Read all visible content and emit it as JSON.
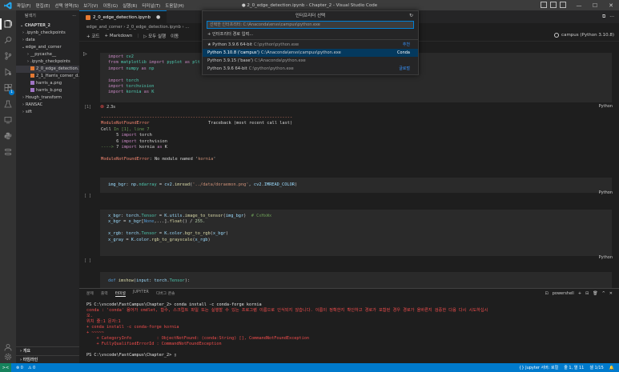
{
  "titlebar": {
    "menu": [
      "파일(F)",
      "편집(E)",
      "선택 영역(S)",
      "보기(V)",
      "이동(G)",
      "실행(R)",
      "터미널(T)",
      "도움말(H)"
    ],
    "title": "● 2_0_edge_detection.ipynb - Chapter_2 - Visual Studio Code",
    "minimize": "—",
    "maximize": "☐",
    "close": "✕"
  },
  "activity": {
    "extensions_badge": "1"
  },
  "sidebar": {
    "header": "탐색기",
    "header_more": "···",
    "section": "CHAPTER_2",
    "items": [
      {
        "label": ".ipynb_checkpoints",
        "indent": 0,
        "type": "folder",
        "expanded": false
      },
      {
        "label": "data",
        "indent": 0,
        "type": "folder",
        "expanded": false
      },
      {
        "label": "edge_and_corner",
        "indent": 0,
        "type": "folder",
        "expanded": true
      },
      {
        "label": "__pycache__",
        "indent": 1,
        "type": "folder",
        "expanded": false
      },
      {
        "label": ".ipynb_checkpoints",
        "indent": 1,
        "type": "folder",
        "expanded": false
      },
      {
        "label": "2_0_edge_detection....",
        "indent": 1,
        "type": "notebook",
        "selected": true
      },
      {
        "label": "2_1_Harris_corner_d...",
        "indent": 1,
        "type": "notebook"
      },
      {
        "label": "harris_a.png",
        "indent": 1,
        "type": "image"
      },
      {
        "label": "harris_b.png",
        "indent": 1,
        "type": "image"
      },
      {
        "label": "Hough_transform",
        "indent": 0,
        "type": "folder",
        "expanded": false
      },
      {
        "label": "RANSAC",
        "indent": 0,
        "type": "folder",
        "expanded": false
      },
      {
        "label": "sift",
        "indent": 0,
        "type": "folder",
        "expanded": false
      }
    ],
    "outline": "개요",
    "timeline": "타임라인"
  },
  "tabs": [
    {
      "label": "2_0_edge_detection.ipynb",
      "close": "●"
    }
  ],
  "breadcrumb": "edge_and_corner  ›  2_0_edge_detection.ipynb  ›  ...",
  "toolbar": {
    "code": "+ 코드",
    "markdown": "+ Markdown",
    "run_all": "▷ 모두 실행",
    "move": "이동",
    "kernel": "campus (Python 3.10.8)"
  },
  "palette": {
    "title": "인터프리터 선택",
    "refresh": "↻",
    "placeholder": "선택한 인터프리터: C:\\Anaconda\\envs\\campus\\python.exe",
    "items": [
      {
        "label": "+  인터프리터 경로 입력...",
        "path": "",
        "tag": ""
      },
      {
        "label": "★ Python 3.9.6 64-bit",
        "path": "C:\\python\\python.exe",
        "tag": "추천"
      },
      {
        "label": "Python 3.10.8 ('campus')",
        "path": "C:\\Anaconda\\envs\\campus\\python.exe",
        "tag": "Conda",
        "active": true
      },
      {
        "label": "Python 3.9.15 ('base')",
        "path": "C:\\Anaconda\\python.exe",
        "tag": ""
      },
      {
        "label": "Python 3.9.6 64-bit",
        "path": "C:\\python\\python.exe",
        "tag": "글로벌"
      }
    ]
  },
  "cells": {
    "cell1": {
      "exec": "[1]",
      "lang": "Python",
      "status_icon": "⊗",
      "status_time": "2.3s",
      "lines": [
        [
          [
            "kw",
            "import "
          ],
          [
            "mod",
            "cv2"
          ]
        ],
        [
          [
            "kw",
            "from "
          ],
          [
            "mod",
            "matplotlib "
          ],
          [
            "kw",
            "import "
          ],
          [
            "mod",
            "pyplot "
          ],
          [
            "kw",
            "as "
          ],
          [
            "mod",
            "plt"
          ]
        ],
        [
          [
            "kw",
            "import "
          ],
          [
            "mod",
            "numpy "
          ],
          [
            "kw",
            "as "
          ],
          [
            "mod",
            "np"
          ]
        ],
        [
          [
            "plain",
            ""
          ]
        ],
        [
          [
            "kw",
            "import "
          ],
          [
            "mod",
            "torch"
          ]
        ],
        [
          [
            "kw",
            "import "
          ],
          [
            "mod",
            "torchvision"
          ]
        ],
        [
          [
            "kw",
            "import "
          ],
          [
            "mod",
            "kornia "
          ],
          [
            "kw",
            "as "
          ],
          [
            "mod",
            "K"
          ]
        ]
      ]
    },
    "error": {
      "divider": "---------------------------------------------------------------------------",
      "lines": [
        [
          [
            "err",
            "ModuleNotFoundError"
          ],
          [
            "plain",
            "                       Traceback (most recent call last)"
          ]
        ],
        [
          [
            "plain",
            "Cell "
          ],
          [
            "grn",
            "In [1], line 7"
          ]
        ],
        [
          [
            "plain",
            "      5 "
          ],
          [
            "kw",
            "import "
          ],
          [
            "plain",
            "torch"
          ]
        ],
        [
          [
            "plain",
            "      6 "
          ],
          [
            "kw",
            "import "
          ],
          [
            "plain",
            "torchvision"
          ]
        ],
        [
          [
            "grn",
            "----> "
          ],
          [
            "plain",
            "7 "
          ],
          [
            "kw",
            "import "
          ],
          [
            "plain",
            "kornia "
          ],
          [
            "kw",
            "as "
          ],
          [
            "plain",
            "K"
          ]
        ],
        [
          [
            "plain",
            ""
          ]
        ],
        [
          [
            "err",
            "ModuleNotFoundError"
          ],
          [
            "plain",
            ": No module named '"
          ],
          [
            "str",
            "kornia"
          ],
          [
            "plain",
            "'"
          ]
        ]
      ]
    },
    "cell2": {
      "exec": "[ ]",
      "lang": "Python",
      "lines": [
        [
          [
            "var",
            "img_bgr"
          ],
          [
            "plain",
            ": "
          ],
          [
            "var",
            "np"
          ],
          [
            "plain",
            "."
          ],
          [
            "mod",
            "ndarray"
          ],
          [
            "plain",
            " = "
          ],
          [
            "var",
            "cv2"
          ],
          [
            "plain",
            "."
          ],
          [
            "fn",
            "imread"
          ],
          [
            "plain",
            "("
          ],
          [
            "str",
            "'../data/doraemon.png'"
          ],
          [
            "plain",
            ", "
          ],
          [
            "var",
            "cv2"
          ],
          [
            "plain",
            "."
          ],
          [
            "var",
            "IMREAD_COLOR"
          ],
          [
            "plain",
            ")"
          ]
        ]
      ]
    },
    "cell3": {
      "exec": "[ ]",
      "lang": "Python",
      "lines": [
        [
          [
            "var",
            "x_bgr"
          ],
          [
            "plain",
            ": "
          ],
          [
            "var",
            "torch"
          ],
          [
            "plain",
            "."
          ],
          [
            "mod",
            "Tensor"
          ],
          [
            "plain",
            " = "
          ],
          [
            "var",
            "K"
          ],
          [
            "plain",
            "."
          ],
          [
            "var",
            "utils"
          ],
          [
            "plain",
            "."
          ],
          [
            "fn",
            "image_to_tensor"
          ],
          [
            "plain",
            "("
          ],
          [
            "var",
            "img_bgr"
          ],
          [
            "plain",
            ")  "
          ],
          [
            "cm",
            "# CxHxWx"
          ]
        ],
        [
          [
            "var",
            "x_bgr"
          ],
          [
            "plain",
            " = "
          ],
          [
            "var",
            "x_bgr"
          ],
          [
            "plain",
            "["
          ],
          [
            "blu",
            "None"
          ],
          [
            "plain",
            ",...]."
          ],
          [
            "fn",
            "float"
          ],
          [
            "plain",
            "() / "
          ],
          [
            "num",
            "255."
          ]
        ],
        [
          [
            "plain",
            ""
          ]
        ],
        [
          [
            "var",
            "x_rgb"
          ],
          [
            "plain",
            ": "
          ],
          [
            "var",
            "torch"
          ],
          [
            "plain",
            "."
          ],
          [
            "mod",
            "Tensor"
          ],
          [
            "plain",
            " = "
          ],
          [
            "var",
            "K"
          ],
          [
            "plain",
            "."
          ],
          [
            "var",
            "color"
          ],
          [
            "plain",
            "."
          ],
          [
            "fn",
            "bgr_to_rgb"
          ],
          [
            "plain",
            "("
          ],
          [
            "var",
            "x_bgr"
          ],
          [
            "plain",
            ")"
          ]
        ],
        [
          [
            "var",
            "x_gray"
          ],
          [
            "plain",
            " = "
          ],
          [
            "var",
            "K"
          ],
          [
            "plain",
            "."
          ],
          [
            "var",
            "color"
          ],
          [
            "plain",
            "."
          ],
          [
            "fn",
            "rgb_to_grayscale"
          ],
          [
            "plain",
            "("
          ],
          [
            "var",
            "x_rgb"
          ],
          [
            "plain",
            ")"
          ]
        ]
      ]
    },
    "cell4": {
      "lines": [
        [
          [
            "blu",
            "def "
          ],
          [
            "fn",
            "imshow"
          ],
          [
            "plain",
            "("
          ],
          [
            "var",
            "input"
          ],
          [
            "plain",
            ": "
          ],
          [
            "var",
            "torch"
          ],
          [
            "plain",
            "."
          ],
          [
            "mod",
            "Tensor"
          ],
          [
            "plain",
            "):"
          ]
        ]
      ]
    }
  },
  "panel": {
    "tabs": [
      "문제",
      "출력",
      "터미널",
      "JUPYTER",
      "디버그 콘솔"
    ],
    "active_tab": 2,
    "shell": "powershell",
    "right_icons": [
      "+",
      "⊟",
      "🗑",
      "^",
      "✕"
    ],
    "terminal": [
      {
        "cls": "term-white",
        "text": "PS C:\\vscode\\FastCampus\\Chapter_2> conda install -c conda-forge kornia"
      },
      {
        "cls": "term-red",
        "text": "conda : 'conda' 용어가 cmdlet, 함수, 스크립트 파일 또는 실행할 수 있는 프로그램 이름으로 인식되지 않습니다. 이름이 정확한지 확인하고 경로가 포함된 경우 경로가 올바른지 검증한 다음 다시 시도하십시"
      },
      {
        "cls": "term-red",
        "text": "오."
      },
      {
        "cls": "term-red",
        "text": "위치 줄:1 문자:1"
      },
      {
        "cls": "term-red",
        "text": "+ conda install -c conda-forge kornia"
      },
      {
        "cls": "term-red",
        "text": "+ ~~~~~"
      },
      {
        "cls": "term-red",
        "text": "    + CategoryInfo          : ObjectNotFound: (conda:String) [], CommandNotFoundException"
      },
      {
        "cls": "term-red",
        "text": "    + FullyQualifiedErrorId : CommandNotFoundException"
      },
      {
        "cls": "term-white",
        "text": ""
      },
      {
        "cls": "term-white",
        "text": "PS C:\\vscode\\FastCampus\\Chapter_2> ▯"
      }
    ]
  },
  "statusbar": {
    "remote": "><",
    "errors": "⊗ 0",
    "warnings": "⚠ 0",
    "right": [
      "{} Jupyter 서버: 로컬",
      "줄 1, 열 11",
      "셀 1/15",
      "🔔"
    ]
  },
  "colors": {
    "accent": "#007acc",
    "editor_bg": "#1e1e1e",
    "sidebar_bg": "#252526",
    "error": "#f14c4c"
  }
}
